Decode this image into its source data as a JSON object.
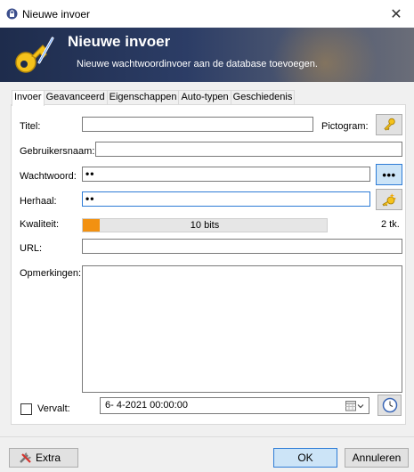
{
  "window": {
    "title": "Nieuwe invoer",
    "close_glyph": "✕"
  },
  "banner": {
    "title": "Nieuwe invoer",
    "subtitle": "Nieuwe wachtwoordinvoer aan de database toevoegen."
  },
  "tabs": [
    {
      "label": "Invoer",
      "active": true
    },
    {
      "label": "Geavanceerd"
    },
    {
      "label": "Eigenschappen"
    },
    {
      "label": "Auto-typen"
    },
    {
      "label": "Geschiedenis"
    }
  ],
  "form": {
    "title_label": "Titel:",
    "title_value": "",
    "icon_label": "Pictogram:",
    "username_label": "Gebruikersnaam:",
    "username_value": "",
    "password_label": "Wachtwoord:",
    "password_value": "••",
    "repeat_label": "Herhaal:",
    "repeat_value": "••",
    "quality_label": "Kwaliteit:",
    "quality_text": "10 bits",
    "quality_fraction": 0.07,
    "quality_chars": "2 tk.",
    "url_label": "URL:",
    "url_value": "",
    "notes_label": "Opmerkingen:",
    "notes_value": "",
    "expires_label": "Vervalt:",
    "expires_checked": false,
    "expires_value": "6- 4-2021 00:00:00"
  },
  "buttons": {
    "extra": "Extra",
    "ok": "OK",
    "cancel": "Annuleren",
    "show_password": "•••"
  },
  "colors": {
    "accent": "#2e7cd6",
    "quality_fill": "#f29111",
    "banner": "#2c3d66"
  },
  "icons": [
    "lock-icon",
    "key-icon",
    "generate-password-icon",
    "calendar-icon",
    "clock-icon",
    "tools-icon"
  ]
}
